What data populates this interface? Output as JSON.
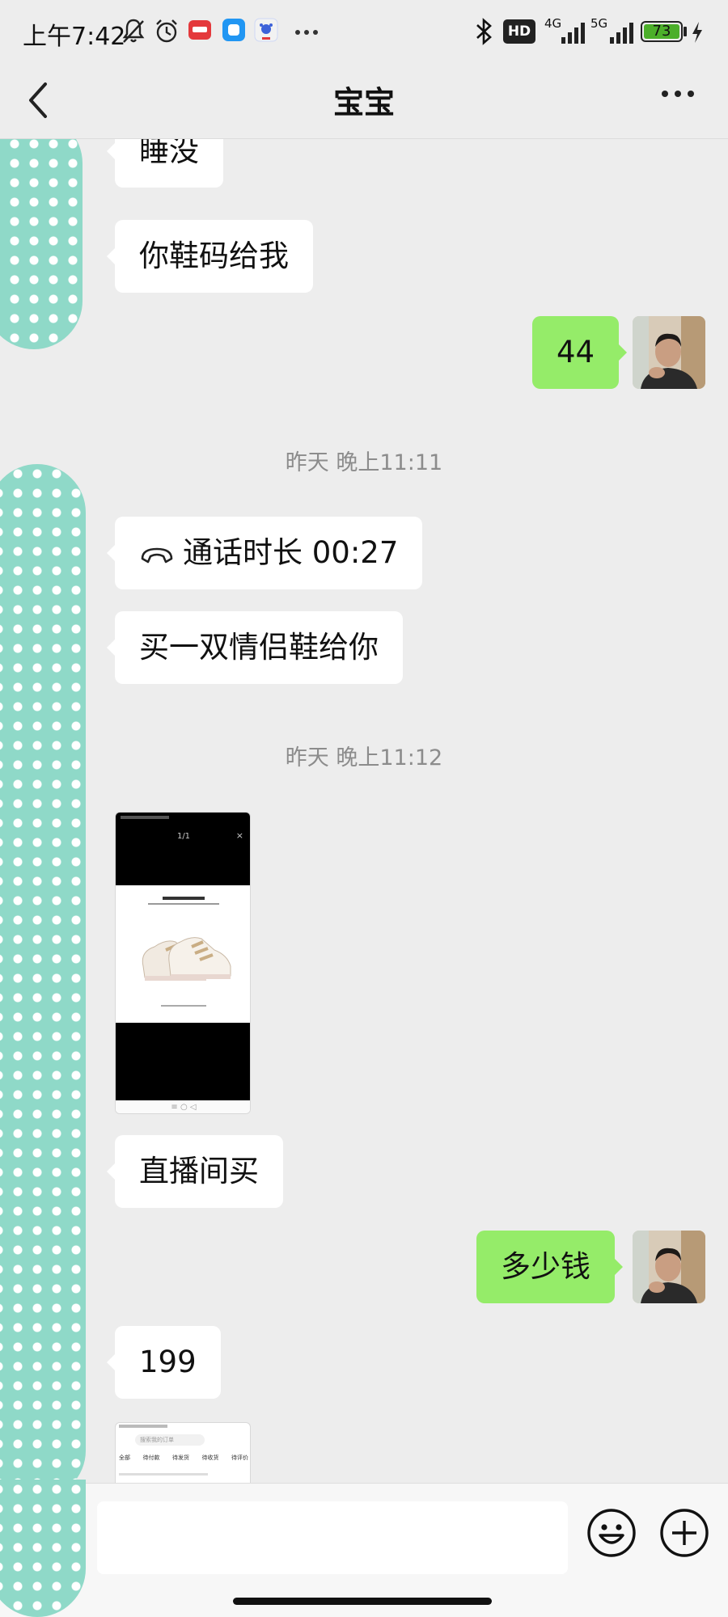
{
  "status_bar": {
    "time": "上午7:42",
    "battery": "73",
    "network_1": "4G",
    "network_2": "5G",
    "hd_label": "HD"
  },
  "header": {
    "title": "宝宝",
    "back_icon": "chevron-left-icon",
    "more_icon": "more-icon"
  },
  "messages": [
    {
      "side": "left",
      "type": "text",
      "text": "睡没"
    },
    {
      "side": "left",
      "type": "text",
      "text": "你鞋码给我"
    },
    {
      "side": "right",
      "type": "text",
      "text": "44"
    },
    {
      "type": "timestamp",
      "text": "昨天 晚上11:11"
    },
    {
      "side": "left",
      "type": "call",
      "text": "通话时长 00:27"
    },
    {
      "side": "left",
      "type": "text",
      "text": "买一双情侣鞋给你"
    },
    {
      "type": "timestamp",
      "text": "昨天 晚上11:12"
    },
    {
      "side": "left",
      "type": "image",
      "inner_text": "1/1"
    },
    {
      "side": "left",
      "type": "text",
      "text": "直播间买"
    },
    {
      "side": "right",
      "type": "text",
      "text": "多少钱"
    },
    {
      "side": "left",
      "type": "text",
      "text": "199"
    },
    {
      "side": "left",
      "type": "image",
      "inner_text": "搜索我的订单",
      "tabs": [
        "全部",
        "待付款",
        "待发货",
        "待收货",
        "待评价"
      ]
    }
  ],
  "input_bar": {
    "placeholder": "",
    "emoji_icon": "emoji-icon",
    "plus_icon": "plus-icon"
  },
  "colors": {
    "background": "#ededed",
    "bubble_right": "#95ec69",
    "bubble_left": "#ffffff",
    "avatar_left": "#8fd9c8"
  }
}
